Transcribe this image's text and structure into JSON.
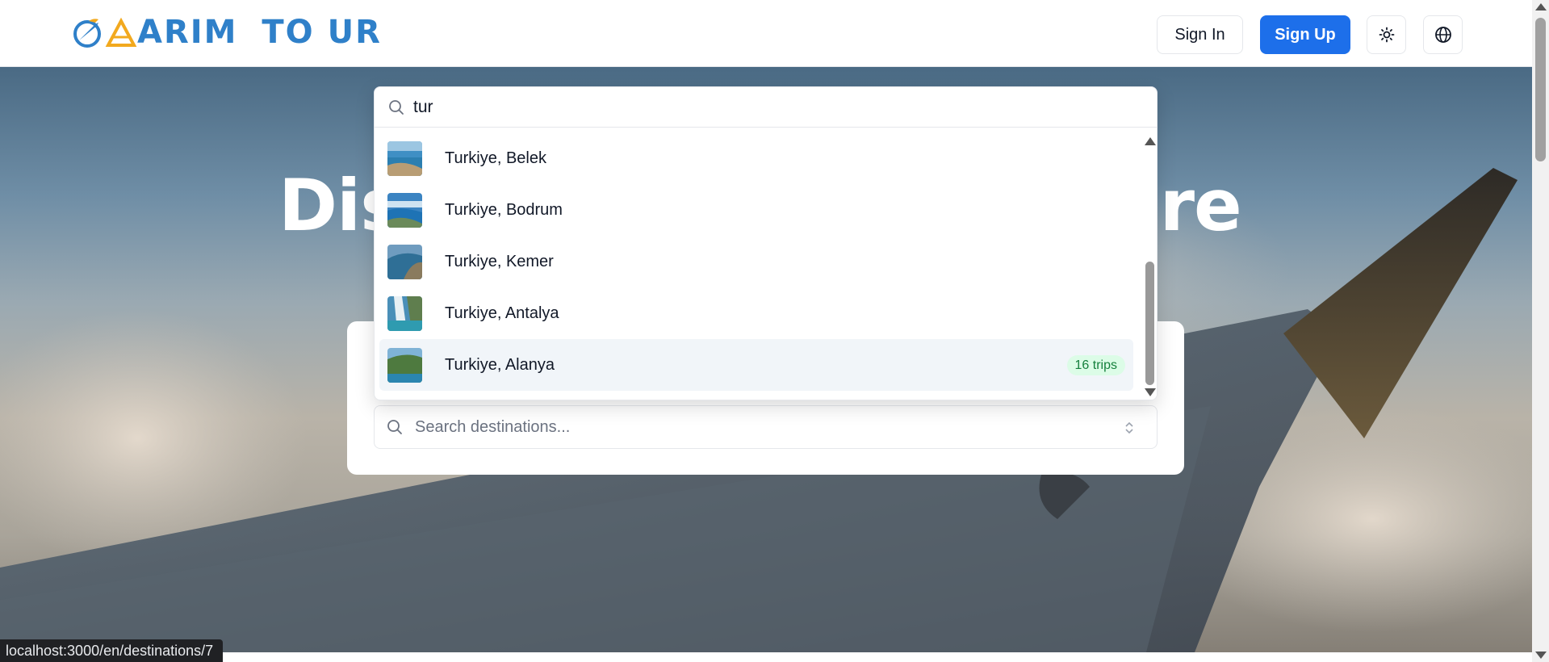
{
  "header": {
    "logo_text_part1": "ARIM",
    "logo_text_part2": "TO",
    "logo_text_part3": "UR",
    "signin_label": "Sign In",
    "signup_label": "Sign Up"
  },
  "hero": {
    "title_left": "Dis",
    "title_right": "ure"
  },
  "search": {
    "query": "tur",
    "placeholder": "Search destinations..."
  },
  "results": [
    {
      "label": "Turkiye, Belek",
      "badge": ""
    },
    {
      "label": "Turkiye, Bodrum",
      "badge": ""
    },
    {
      "label": "Turkiye, Kemer",
      "badge": ""
    },
    {
      "label": "Turkiye, Antalya",
      "badge": ""
    },
    {
      "label": "Turkiye, Alanya",
      "badge": "16 trips"
    }
  ],
  "status_bar": {
    "url": "localhost:3000/en/destinations/7"
  },
  "colors": {
    "primary": "#1d6fea",
    "badge_bg": "#dcfce7",
    "badge_text": "#15803d",
    "logo_blue": "#2f80c9",
    "logo_orange": "#f2a91e"
  }
}
